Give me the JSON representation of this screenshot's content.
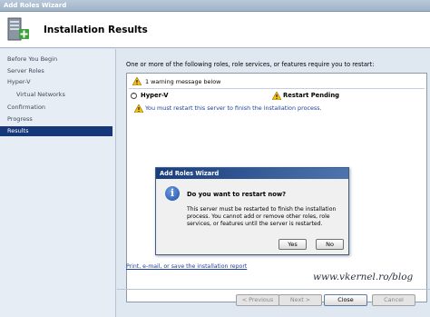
{
  "window": {
    "title": "Add Roles Wizard"
  },
  "header": {
    "title": "Installation Results",
    "icon": "server-roles-add-icon"
  },
  "sidebar": {
    "items": [
      {
        "label": "Before You Begin",
        "active": false,
        "sub": false
      },
      {
        "label": "Server Roles",
        "active": false,
        "sub": false
      },
      {
        "label": "Hyper-V",
        "active": false,
        "sub": false
      },
      {
        "label": "Virtual Networks",
        "active": false,
        "sub": true
      },
      {
        "label": "Confirmation",
        "active": false,
        "sub": false
      },
      {
        "label": "Progress",
        "active": false,
        "sub": false
      },
      {
        "label": "Results",
        "active": true,
        "sub": false
      }
    ]
  },
  "main": {
    "intro": "One or more of the following roles, role services, or features require you to restart:",
    "warning_summary": "1 warning message below",
    "role": {
      "name": "Hyper-V",
      "status": "Restart Pending",
      "message": "You must restart this server to finish the installation process."
    },
    "report_link": "Print, e-mail, or save the installation report"
  },
  "dialog": {
    "title": "Add Roles Wizard",
    "question": "Do you want to restart now?",
    "body": "This server must be restarted to finish the installation process. You cannot add or remove other roles, role services, or features until the server is restarted.",
    "yes_label": "Yes",
    "no_label": "No"
  },
  "footer": {
    "previous_label": "< Previous",
    "next_label": "Next >",
    "close_label": "Close",
    "cancel_label": "Cancel"
  },
  "watermark": "www.vkernel.ro/blog",
  "colors": {
    "accent": "#16387a",
    "link": "#1c3f9e",
    "warning": "#f2c11a"
  }
}
